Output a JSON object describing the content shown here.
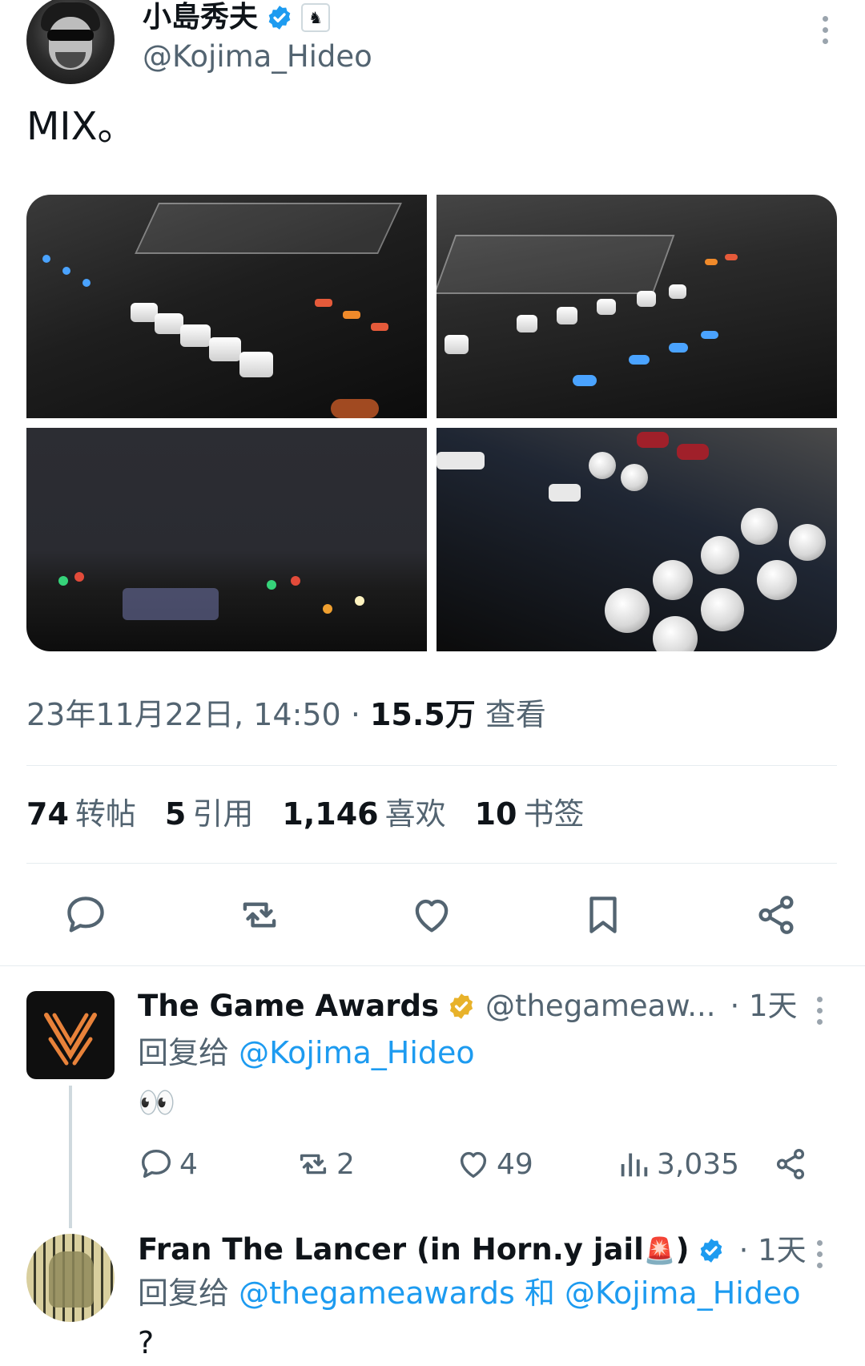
{
  "tweet": {
    "author": {
      "name": "小島秀夫",
      "handle": "@Kojima_Hideo"
    },
    "text": "MIX。",
    "date": "23年11月22日, 14:50",
    "separator": " · ",
    "views_count": "15.5万",
    "views_label": "查看"
  },
  "stats": [
    {
      "count": "74",
      "label": "转帖"
    },
    {
      "count": "5",
      "label": "引用"
    },
    {
      "count": "1,146",
      "label": "喜欢"
    },
    {
      "count": "10",
      "label": "书签"
    }
  ],
  "action_bar": [
    "reply-icon",
    "retweet-icon",
    "like-icon",
    "bookmark-icon",
    "share-icon"
  ],
  "replies": [
    {
      "name": "The Game Awards",
      "handle": "@thegameaw...",
      "time": "· 1天",
      "reply_prefix": "回复给",
      "mention1": "@Kojima_Hideo",
      "text": "👀",
      "counts": {
        "replies": "4",
        "retweets": "2",
        "likes": "49",
        "views": "3,035"
      }
    },
    {
      "name": "Fran The Lancer (in Horn.y jail",
      "name_emoji": "🚨",
      "name_tail": ")",
      "time": "· 1天",
      "reply_prefix": "回复给",
      "mention1": "@thegameawards",
      "conj": "和",
      "mention2": "@Kojima_Hideo",
      "text": "?"
    }
  ],
  "colors": {
    "accent": "#1d9bf0",
    "muted": "#536471",
    "gold": "#e8b22a"
  }
}
